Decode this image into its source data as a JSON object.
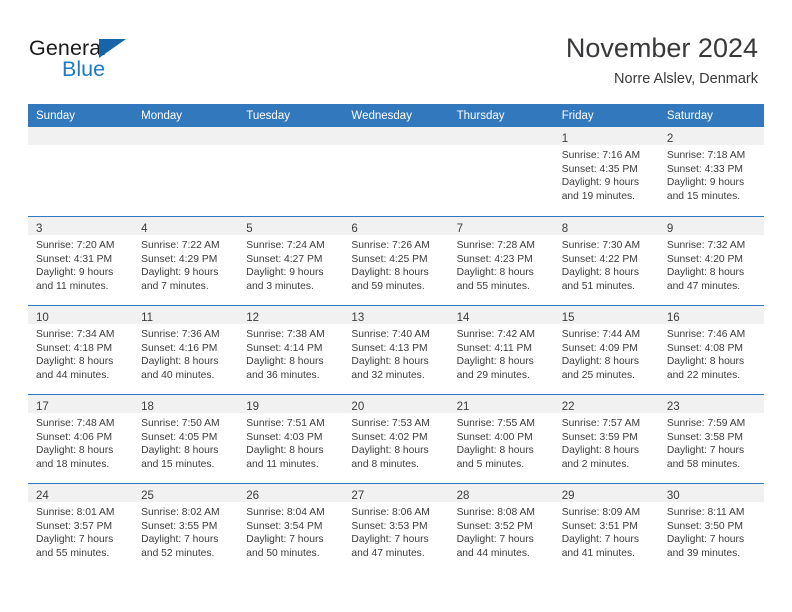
{
  "brand": {
    "name_part1": "General",
    "name_part2": "Blue",
    "triangle_icon": "triangle-logo-icon",
    "accent_color": "#1f7ac4",
    "triangle_color": "#1565a8"
  },
  "header": {
    "title": "November 2024",
    "location": "Norre Alslev, Denmark",
    "header_bg_color": "#3278bd",
    "daynum_band_color": "#f1f1f1",
    "divider_color": "#3278bd"
  },
  "weekday_headers": [
    "Sunday",
    "Monday",
    "Tuesday",
    "Wednesday",
    "Thursday",
    "Friday",
    "Saturday"
  ],
  "weeks": [
    [
      {
        "day": "",
        "lines": []
      },
      {
        "day": "",
        "lines": []
      },
      {
        "day": "",
        "lines": []
      },
      {
        "day": "",
        "lines": []
      },
      {
        "day": "",
        "lines": []
      },
      {
        "day": "1",
        "lines": [
          "Sunrise: 7:16 AM",
          "Sunset: 4:35 PM",
          "Daylight: 9 hours",
          "and 19 minutes."
        ]
      },
      {
        "day": "2",
        "lines": [
          "Sunrise: 7:18 AM",
          "Sunset: 4:33 PM",
          "Daylight: 9 hours",
          "and 15 minutes."
        ]
      }
    ],
    [
      {
        "day": "3",
        "lines": [
          "Sunrise: 7:20 AM",
          "Sunset: 4:31 PM",
          "Daylight: 9 hours",
          "and 11 minutes."
        ]
      },
      {
        "day": "4",
        "lines": [
          "Sunrise: 7:22 AM",
          "Sunset: 4:29 PM",
          "Daylight: 9 hours",
          "and 7 minutes."
        ]
      },
      {
        "day": "5",
        "lines": [
          "Sunrise: 7:24 AM",
          "Sunset: 4:27 PM",
          "Daylight: 9 hours",
          "and 3 minutes."
        ]
      },
      {
        "day": "6",
        "lines": [
          "Sunrise: 7:26 AM",
          "Sunset: 4:25 PM",
          "Daylight: 8 hours",
          "and 59 minutes."
        ]
      },
      {
        "day": "7",
        "lines": [
          "Sunrise: 7:28 AM",
          "Sunset: 4:23 PM",
          "Daylight: 8 hours",
          "and 55 minutes."
        ]
      },
      {
        "day": "8",
        "lines": [
          "Sunrise: 7:30 AM",
          "Sunset: 4:22 PM",
          "Daylight: 8 hours",
          "and 51 minutes."
        ]
      },
      {
        "day": "9",
        "lines": [
          "Sunrise: 7:32 AM",
          "Sunset: 4:20 PM",
          "Daylight: 8 hours",
          "and 47 minutes."
        ]
      }
    ],
    [
      {
        "day": "10",
        "lines": [
          "Sunrise: 7:34 AM",
          "Sunset: 4:18 PM",
          "Daylight: 8 hours",
          "and 44 minutes."
        ]
      },
      {
        "day": "11",
        "lines": [
          "Sunrise: 7:36 AM",
          "Sunset: 4:16 PM",
          "Daylight: 8 hours",
          "and 40 minutes."
        ]
      },
      {
        "day": "12",
        "lines": [
          "Sunrise: 7:38 AM",
          "Sunset: 4:14 PM",
          "Daylight: 8 hours",
          "and 36 minutes."
        ]
      },
      {
        "day": "13",
        "lines": [
          "Sunrise: 7:40 AM",
          "Sunset: 4:13 PM",
          "Daylight: 8 hours",
          "and 32 minutes."
        ]
      },
      {
        "day": "14",
        "lines": [
          "Sunrise: 7:42 AM",
          "Sunset: 4:11 PM",
          "Daylight: 8 hours",
          "and 29 minutes."
        ]
      },
      {
        "day": "15",
        "lines": [
          "Sunrise: 7:44 AM",
          "Sunset: 4:09 PM",
          "Daylight: 8 hours",
          "and 25 minutes."
        ]
      },
      {
        "day": "16",
        "lines": [
          "Sunrise: 7:46 AM",
          "Sunset: 4:08 PM",
          "Daylight: 8 hours",
          "and 22 minutes."
        ]
      }
    ],
    [
      {
        "day": "17",
        "lines": [
          "Sunrise: 7:48 AM",
          "Sunset: 4:06 PM",
          "Daylight: 8 hours",
          "and 18 minutes."
        ]
      },
      {
        "day": "18",
        "lines": [
          "Sunrise: 7:50 AM",
          "Sunset: 4:05 PM",
          "Daylight: 8 hours",
          "and 15 minutes."
        ]
      },
      {
        "day": "19",
        "lines": [
          "Sunrise: 7:51 AM",
          "Sunset: 4:03 PM",
          "Daylight: 8 hours",
          "and 11 minutes."
        ]
      },
      {
        "day": "20",
        "lines": [
          "Sunrise: 7:53 AM",
          "Sunset: 4:02 PM",
          "Daylight: 8 hours",
          "and 8 minutes."
        ]
      },
      {
        "day": "21",
        "lines": [
          "Sunrise: 7:55 AM",
          "Sunset: 4:00 PM",
          "Daylight: 8 hours",
          "and 5 minutes."
        ]
      },
      {
        "day": "22",
        "lines": [
          "Sunrise: 7:57 AM",
          "Sunset: 3:59 PM",
          "Daylight: 8 hours",
          "and 2 minutes."
        ]
      },
      {
        "day": "23",
        "lines": [
          "Sunrise: 7:59 AM",
          "Sunset: 3:58 PM",
          "Daylight: 7 hours",
          "and 58 minutes."
        ]
      }
    ],
    [
      {
        "day": "24",
        "lines": [
          "Sunrise: 8:01 AM",
          "Sunset: 3:57 PM",
          "Daylight: 7 hours",
          "and 55 minutes."
        ]
      },
      {
        "day": "25",
        "lines": [
          "Sunrise: 8:02 AM",
          "Sunset: 3:55 PM",
          "Daylight: 7 hours",
          "and 52 minutes."
        ]
      },
      {
        "day": "26",
        "lines": [
          "Sunrise: 8:04 AM",
          "Sunset: 3:54 PM",
          "Daylight: 7 hours",
          "and 50 minutes."
        ]
      },
      {
        "day": "27",
        "lines": [
          "Sunrise: 8:06 AM",
          "Sunset: 3:53 PM",
          "Daylight: 7 hours",
          "and 47 minutes."
        ]
      },
      {
        "day": "28",
        "lines": [
          "Sunrise: 8:08 AM",
          "Sunset: 3:52 PM",
          "Daylight: 7 hours",
          "and 44 minutes."
        ]
      },
      {
        "day": "29",
        "lines": [
          "Sunrise: 8:09 AM",
          "Sunset: 3:51 PM",
          "Daylight: 7 hours",
          "and 41 minutes."
        ]
      },
      {
        "day": "30",
        "lines": [
          "Sunrise: 8:11 AM",
          "Sunset: 3:50 PM",
          "Daylight: 7 hours",
          "and 39 minutes."
        ]
      }
    ]
  ]
}
